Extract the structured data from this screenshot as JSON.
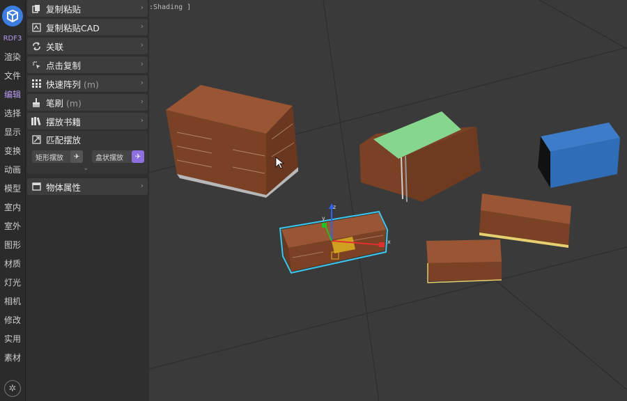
{
  "rail": {
    "brand": "RDF3",
    "items": [
      "渲染",
      "文件",
      "编辑",
      "选择",
      "显示",
      "变换",
      "动画",
      "模型",
      "室内",
      "室外",
      "图形",
      "材质",
      "灯光",
      "相机",
      "修改",
      "实用",
      "素材"
    ],
    "active_index": 2
  },
  "panel": {
    "items": [
      {
        "label": "复制粘贴",
        "icon": "copy-icon"
      },
      {
        "label": "复制粘贴CAD",
        "icon": "cad-copy-icon"
      },
      {
        "label": "关联",
        "icon": "link-icon"
      },
      {
        "label": "点击复制",
        "icon": "click-copy-icon"
      },
      {
        "label": "快速阵列",
        "suffix": "(m)",
        "icon": "grid-icon"
      },
      {
        "label": "笔刷",
        "suffix": "(m)",
        "icon": "brush-icon"
      },
      {
        "label": "摆放书籍",
        "icon": "books-icon"
      }
    ],
    "match": {
      "label": "匹配摆放",
      "buttons": [
        "矩形摆放",
        "盒状摆放"
      ],
      "active_button": 1
    },
    "object_props": "物体属性"
  },
  "viewport": {
    "label": ":Shading ]",
    "accent_selection": "#38c8f0",
    "gizmo_x": "#e03030",
    "gizmo_y": "#20c020",
    "gizmo_z": "#3060ff"
  }
}
